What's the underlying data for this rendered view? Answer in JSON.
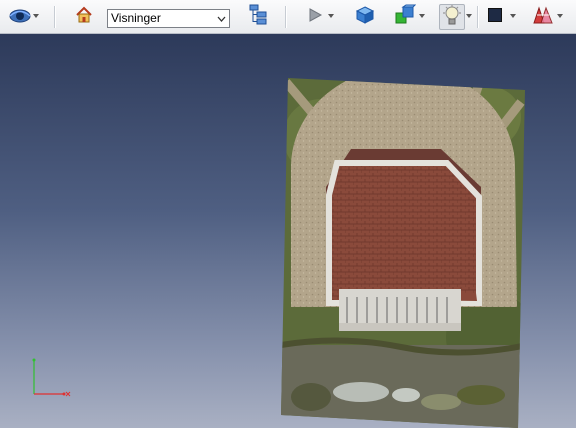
{
  "toolbar": {
    "view_select": {
      "value": "Visninger"
    },
    "icons": [
      "navigation-mode-icon",
      "home-view-icon",
      "model-tree-icon",
      "play-animation-icon",
      "bounding-box-icon",
      "object-visibility-icon",
      "lighting-icon",
      "background-color-icon",
      "rendering-style-icon"
    ],
    "background_color_swatch": "#1e2a44"
  },
  "viewport": {
    "background_top": "#2d3a5a",
    "background_bottom": "#a9b0c3",
    "axis_colors": {
      "x": "#e03030",
      "y": "#30c030"
    }
  }
}
